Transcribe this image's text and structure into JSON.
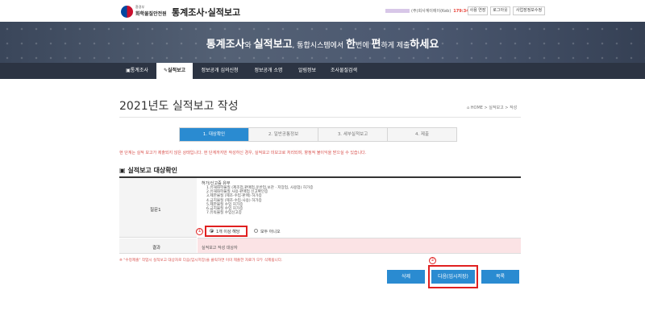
{
  "header": {
    "agency_small": "환경부",
    "agency_name": "화학물질안전원",
    "site_title": "통계조사·실적보고",
    "user_company": "(주)회사계이에이(Keb)",
    "timer": "179:34",
    "buttons": [
      "사용 연장",
      "로그아웃",
      "사업장정보수정"
    ]
  },
  "banner": {
    "part1": "통계조사",
    "part2": "와 ",
    "part3": "실적보고",
    "part4": ", 통합시스템에서 ",
    "part5": "한",
    "part6": "번에 ",
    "part7": "편",
    "part8": "하게 제출",
    "part9": "하세요"
  },
  "nav": {
    "items": [
      "통계조사",
      "실적보고",
      "정보공개 심의신청",
      "정보공개 소명",
      "알림정보",
      "조사물질검색"
    ],
    "active_index": 1,
    "icons": [
      "document-icon",
      "pencil-icon"
    ]
  },
  "page": {
    "title": "2021년도 실적보고 작성",
    "breadcrumb": "HOME > 실적보고 > 작성"
  },
  "steps": {
    "items": [
      "1. 대상확인",
      "2. 일반공통정보",
      "3. 세부실적보고",
      "4. 제출"
    ],
    "active_index": 0
  },
  "notice": "현 단계는 실적 보고가 제출되지 않은 상태입니다. 현 단계까지만 작성하신 경우, 실적보고 미보고로 처리되며, 향정적 불이익을 받으실 수 있습니다.",
  "section": {
    "title": "실적보고 대상확인"
  },
  "question": {
    "label": "질문1",
    "title": "허가/신고증 유무",
    "items": [
      "1.유해화학물질 (제조업,판매업,운반업,보관 · 저장업, 사용업) 허가증",
      "2.유해화학물질 사용·판매업 신고확인증",
      "3.제한물질 (제조·수입·판매) 허가증",
      "4.금지물질 (제조·수입·사용) 허가증",
      "5.제한물질 수입 허가증",
      "6.금지물질 수입 허가증",
      "7.유독물질 수입신고증"
    ],
    "options": [
      "1개 이상 해당",
      "모두 아니오"
    ],
    "selected_index": 0,
    "marker": "①"
  },
  "result": {
    "label": "결과",
    "value": "실적보고 작성 대상자"
  },
  "footnote": "※ \"수정제출\" 작업시 실적보고 대상자로 다음(임시저장)을 클릭하면 이미 제출한 자료가 모두 삭제됩니다.",
  "buttons": {
    "delete": "삭제",
    "next": "다음(임시저장)",
    "list": "목록",
    "marker": "②"
  },
  "colors": {
    "accent": "#2a8bd1",
    "highlight_border": "#e02020",
    "nav_bg": "#2c3443",
    "result_bg": "#fbe3e5"
  }
}
